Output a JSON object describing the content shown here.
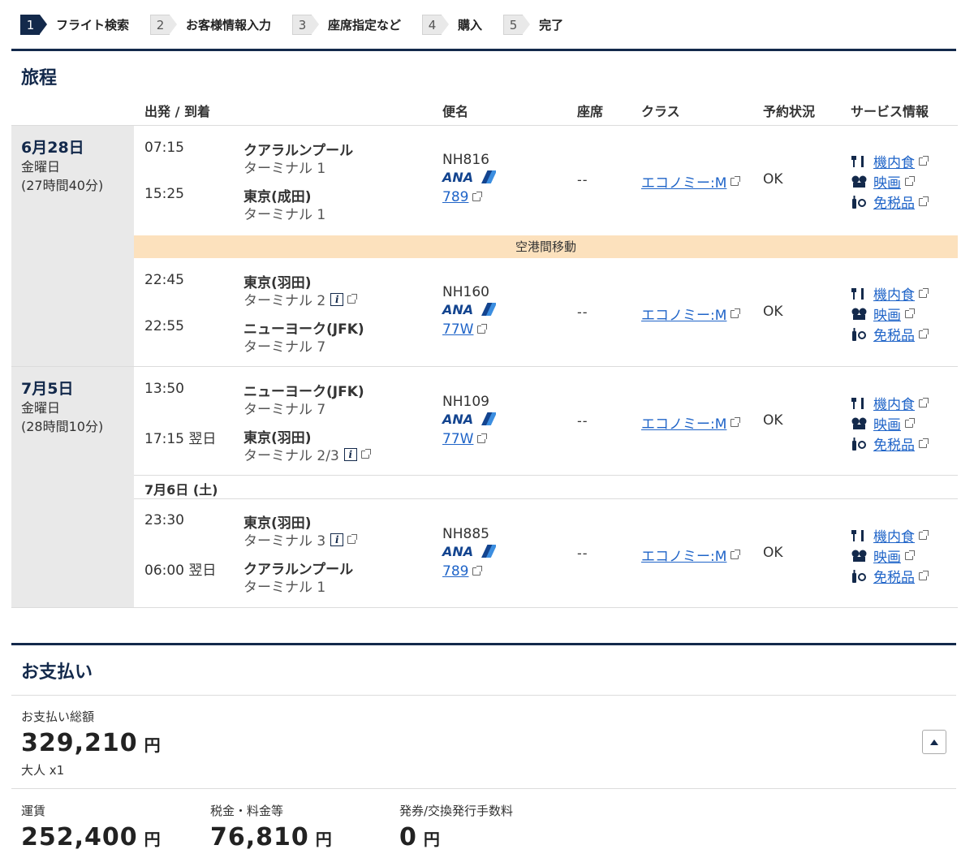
{
  "steps": [
    {
      "num": "1",
      "label": "フライト検索"
    },
    {
      "num": "2",
      "label": "お客様情報入力"
    },
    {
      "num": "3",
      "label": "座席指定など"
    },
    {
      "num": "4",
      "label": "購入"
    },
    {
      "num": "5",
      "label": "完了"
    }
  ],
  "itinerary": {
    "title": "旅程",
    "headers": {
      "dep_arr": "出発 / 到着",
      "flight": "便名",
      "seat": "座席",
      "class": "クラス",
      "status": "予約状況",
      "service": "サービス情報"
    },
    "days": [
      {
        "date": "6月28日",
        "weekday": "金曜日",
        "duration": "(27時間40分)"
      },
      {
        "date": "7月5日",
        "weekday": "金曜日",
        "duration": "(28時間10分)"
      }
    ],
    "transfer_label": "空港間移動",
    "sub_date": "7月6日 (土)",
    "services": {
      "meal": "機内食",
      "movie": "映画",
      "dutyfree": "免税品"
    },
    "segments": [
      {
        "dep_time": "07:15",
        "dep_city": "クアラルンプール",
        "dep_terminal": "ターミナル 1",
        "arr_time": "15:25",
        "arr_city": "東京(成田)",
        "arr_terminal": "ターミナル 1",
        "flight_no": "NH816",
        "airline_logo": "ANA",
        "aircraft": "789",
        "seat": "--",
        "class": "エコノミー:M",
        "status": "OK"
      },
      {
        "dep_time": "22:45",
        "dep_city": "東京(羽田)",
        "dep_terminal": "ターミナル 2",
        "arr_time": "22:55",
        "arr_city": "ニューヨーク(JFK)",
        "arr_terminal": "ターミナル 7",
        "flight_no": "NH160",
        "airline_logo": "ANA",
        "aircraft": "77W",
        "seat": "--",
        "class": "エコノミー:M",
        "status": "OK"
      },
      {
        "dep_time": "13:50",
        "dep_city": "ニューヨーク(JFK)",
        "dep_terminal": "ターミナル 7",
        "arr_time": "17:15 翌日",
        "arr_city": "東京(羽田)",
        "arr_terminal": "ターミナル 2/3",
        "flight_no": "NH109",
        "airline_logo": "ANA",
        "aircraft": "77W",
        "seat": "--",
        "class": "エコノミー:M",
        "status": "OK"
      },
      {
        "dep_time": "23:30",
        "dep_city": "東京(羽田)",
        "dep_terminal": "ターミナル 3",
        "arr_time": "06:00 翌日",
        "arr_city": "クアラルンプール",
        "arr_terminal": "ターミナル 1",
        "flight_no": "NH885",
        "airline_logo": "ANA",
        "aircraft": "789",
        "seat": "--",
        "class": "エコノミー:M",
        "status": "OK"
      }
    ]
  },
  "payment": {
    "title": "お支払い",
    "total_label": "お支払い総額",
    "total_amount": "329,210",
    "currency": "円",
    "passengers": "大人 x1",
    "breakdown": [
      {
        "label": "運賃",
        "amount": "252,400"
      },
      {
        "label": "税金・料金等",
        "amount": "76,810"
      },
      {
        "label": "発券/交換発行手数料",
        "amount": "0"
      }
    ]
  },
  "colors": {
    "brand_navy": "#13294b",
    "link": "#1f64c8",
    "transfer_bg": "#fce1bd"
  }
}
